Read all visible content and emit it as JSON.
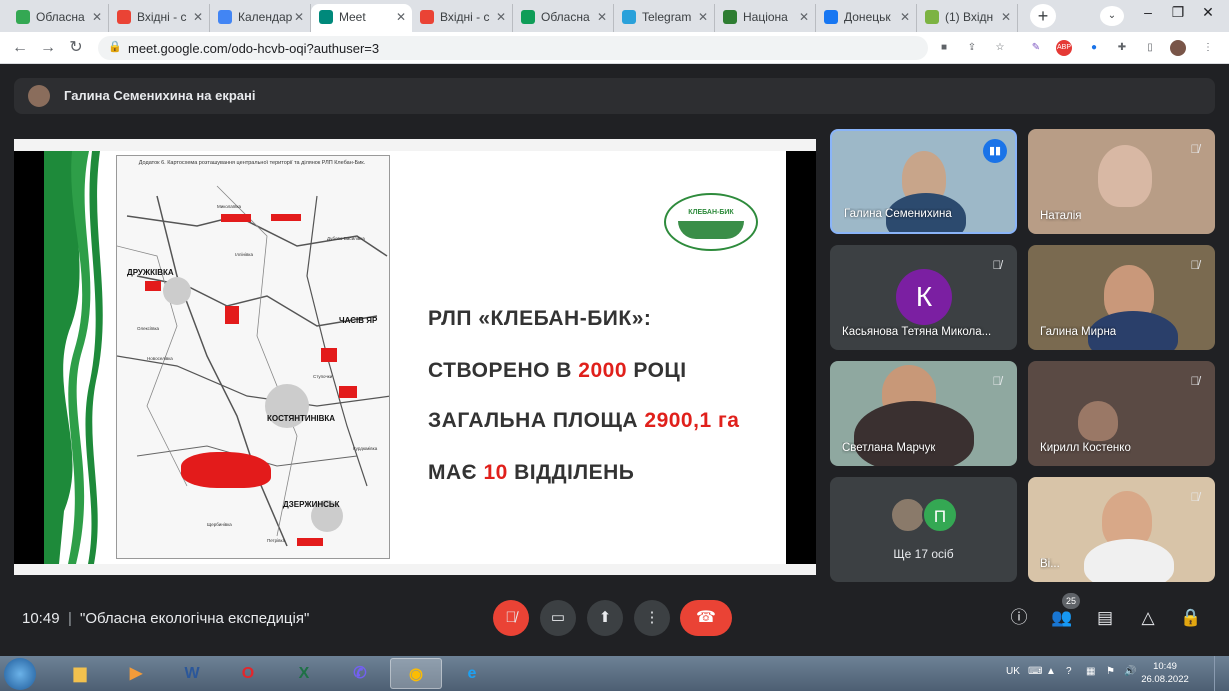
{
  "browser": {
    "tabs": [
      {
        "label": "Обласна",
        "fav": "doc-favicon",
        "color": "#34a853"
      },
      {
        "label": "Вхідні - с",
        "fav": "gmail-favicon",
        "color": "#ea4335"
      },
      {
        "label": "Календар",
        "fav": "calendar-favicon",
        "color": "#4285f4"
      },
      {
        "label": "Meet",
        "fav": "meet-favicon",
        "color": "#00897b",
        "active": true
      },
      {
        "label": "Вхідні - с",
        "fav": "gmail-favicon",
        "color": "#ea4335"
      },
      {
        "label": "Обласна",
        "fav": "sheets-favicon",
        "color": "#0f9d58"
      },
      {
        "label": "Telegram",
        "fav": "telegram-favicon",
        "color": "#2aa1da"
      },
      {
        "label": "Націона",
        "fav": "site-favicon",
        "color": "#2e7d32"
      },
      {
        "label": "Донецьк",
        "fav": "facebook-favicon",
        "color": "#1877f2"
      },
      {
        "label": "(1) Вхідн",
        "fav": "mail-favicon",
        "color": "#7cb342"
      }
    ],
    "url": "meet.google.com/odo-hcvb-oqi?authuser=3"
  },
  "meet": {
    "presenting_banner": "Галина Семенихина на екрані",
    "time": "10:49",
    "meeting_title": "\"Обласна екологічна експедиція\"",
    "participant_count": "25",
    "more_label": "Ще 17 осіб",
    "more_avatar_letter": "П"
  },
  "slide": {
    "map_title": "Додаток 6. Картосхема розташування центральної території та ділянок РЛП Клебан-Бик.",
    "cities": [
      "ДРУЖКІВКА",
      "ЧАСІВ ЯР",
      "КОСТЯНТИНІВКА",
      "ДЗЕРЖИНСЬК"
    ],
    "villages": [
      "Миколаївка",
      "Олексіївка",
      "Іллінівка",
      "Дубово-Василівка",
      "Щербинівка",
      "Курдюмівка",
      "Петрівка",
      "Новоселівка",
      "Ступочки"
    ],
    "logo_text": "КЛЕБАН-БИК",
    "line1": "РЛП «КЛЕБАН-БИК»:",
    "line2_pre": "СТВОРЕНО В ",
    "line2_red": "2000",
    "line2_post": " РОЦІ",
    "line3_pre": "ЗАГАЛЬНА ПЛОЩА ",
    "line3_red": "2900,1 га",
    "line4_pre": "МАЄ ",
    "line4_red": "10",
    "line4_post": " ВІДДІЛЕНЬ"
  },
  "participants": [
    {
      "name": "Галина Семенихина",
      "speaking": true
    },
    {
      "name": "Наталія"
    },
    {
      "name": "Касьянова Тетяна Микола...",
      "avatar_letter": "К"
    },
    {
      "name": "Галина Мирна"
    },
    {
      "name": "Светлана Марчук"
    },
    {
      "name": "Кирилл Костенко"
    },
    {
      "name": "Ві..."
    }
  ],
  "taskbar": {
    "lang": "UK",
    "time": "10:49",
    "date": "26.08.2022"
  }
}
